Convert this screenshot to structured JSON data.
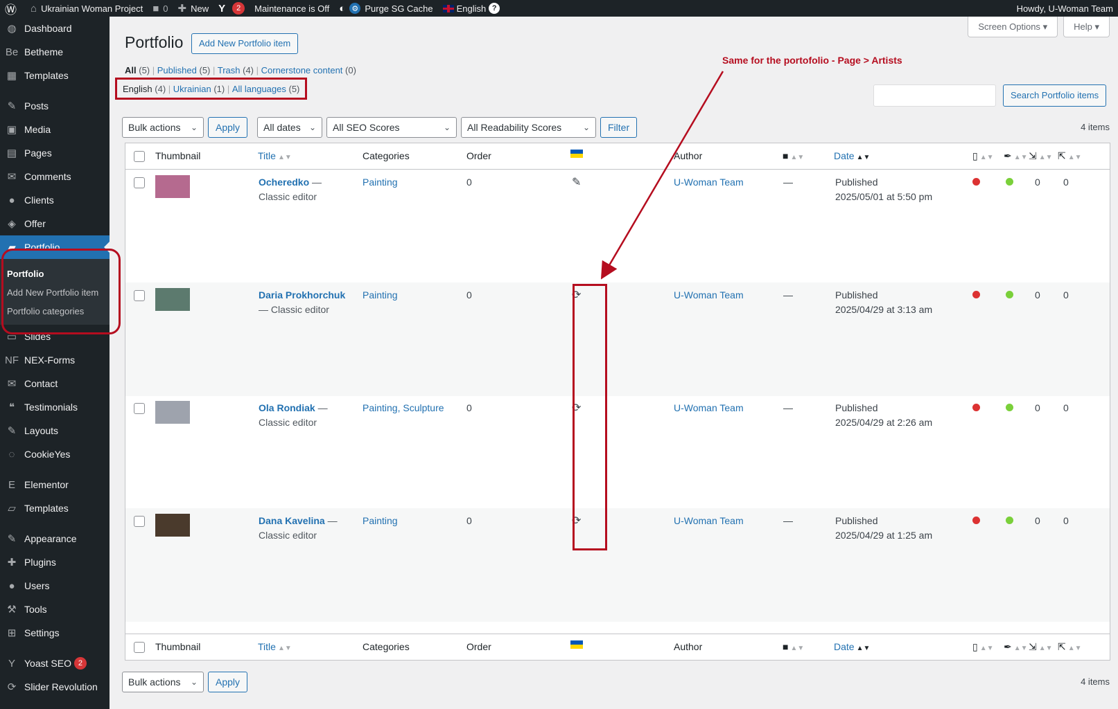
{
  "adminbar": {
    "site": "Ukrainian Woman Project",
    "comments": "0",
    "new_label": "New",
    "yoast_count": "2",
    "maintenance": "Maintenance is Off",
    "purge": "Purge SG Cache",
    "language": "English",
    "howdy": "Howdy, U-Woman Team"
  },
  "sidebar": {
    "items": [
      {
        "label": "Dashboard",
        "icon": "dashboard-icon",
        "glyph": "◍"
      },
      {
        "label": "Betheme",
        "icon": "betheme-icon",
        "glyph": "Be"
      },
      {
        "label": "Templates",
        "icon": "templates-icon",
        "glyph": "▦"
      },
      {
        "label": "Posts",
        "icon": "pin-icon",
        "glyph": "✎"
      },
      {
        "label": "Media",
        "icon": "media-icon",
        "glyph": "▣"
      },
      {
        "label": "Pages",
        "icon": "pages-icon",
        "glyph": "▤"
      },
      {
        "label": "Comments",
        "icon": "comments-icon",
        "glyph": "✉"
      },
      {
        "label": "Clients",
        "icon": "clients-icon",
        "glyph": "●"
      },
      {
        "label": "Offer",
        "icon": "offer-icon",
        "glyph": "◈"
      },
      {
        "label": "Portfolio",
        "icon": "portfolio-icon",
        "glyph": "▰"
      },
      {
        "label": "Slides",
        "icon": "slides-icon",
        "glyph": "▭"
      },
      {
        "label": "NEX-Forms",
        "icon": "nex-forms-icon",
        "glyph": "NF"
      },
      {
        "label": "Contact",
        "icon": "contact-icon",
        "glyph": "✉"
      },
      {
        "label": "Testimonials",
        "icon": "quote-icon",
        "glyph": "❝"
      },
      {
        "label": "Layouts",
        "icon": "layouts-icon",
        "glyph": "✎"
      },
      {
        "label": "CookieYes",
        "icon": "cookieyes-icon",
        "glyph": "◌"
      },
      {
        "label": "Elementor",
        "icon": "elementor-icon",
        "glyph": "E"
      },
      {
        "label": "Templates",
        "icon": "folder-icon",
        "glyph": "▱"
      },
      {
        "label": "Appearance",
        "icon": "appearance-icon",
        "glyph": "✎"
      },
      {
        "label": "Plugins",
        "icon": "plugins-icon",
        "glyph": "✚"
      },
      {
        "label": "Users",
        "icon": "users-icon",
        "glyph": "●"
      },
      {
        "label": "Tools",
        "icon": "tools-icon",
        "glyph": "⚒"
      },
      {
        "label": "Settings",
        "icon": "settings-icon",
        "glyph": "⊞"
      },
      {
        "label": "Yoast SEO",
        "icon": "yoast-icon",
        "glyph": "Y",
        "badge": "2"
      },
      {
        "label": "Slider Revolution",
        "icon": "slider-revolution-icon",
        "glyph": "⟳"
      }
    ],
    "submenu": [
      "Portfolio",
      "Add New Portfolio item",
      "Portfolio categories"
    ]
  },
  "page": {
    "title": "Portfolio",
    "add_new": "Add New Portfolio item",
    "screen_options": "Screen Options",
    "help": "Help",
    "subsubsub": [
      {
        "label": "All",
        "count": "(5)"
      },
      {
        "label": "Published",
        "count": "(5)"
      },
      {
        "label": "Trash",
        "count": "(4)"
      },
      {
        "label": "Cornerstone content",
        "count": "(0)"
      }
    ],
    "languages": [
      {
        "label": "English",
        "count": "(4)"
      },
      {
        "label": "Ukrainian",
        "count": "(1)"
      },
      {
        "label": "All languages",
        "count": "(5)"
      }
    ],
    "annotation": "Same for the portofolio - Page > Artists",
    "search_button": "Search Portfolio items",
    "bulk_actions": "Bulk actions",
    "apply": "Apply",
    "all_dates": "All dates",
    "all_seo": "All SEO Scores",
    "all_readability": "All Readability Scores",
    "filter": "Filter",
    "items_count": "4 items"
  },
  "table": {
    "columns": {
      "thumbnail": "Thumbnail",
      "title": "Title",
      "categories": "Categories",
      "order": "Order",
      "author": "Author",
      "date": "Date"
    },
    "rows": [
      {
        "name": "Ocheredko",
        "suffix": " — Classic editor",
        "categories": "Painting",
        "order": "0",
        "lang_icon": "pencil-icon",
        "lang_glyph": "✎",
        "author": "U-Woman Team",
        "comments": "—",
        "status": "Published",
        "date": "2025/05/01 at 5:50 pm",
        "links_out": "0",
        "links_in": "0",
        "thumb_color": "#b56a8f"
      },
      {
        "name": "Daria Prokhorchuk",
        "suffix": " — Classic editor",
        "categories": "Painting",
        "order": "0",
        "lang_icon": "sync-icon",
        "lang_glyph": "⟳",
        "author": "U-Woman Team",
        "comments": "—",
        "status": "Published",
        "date": "2025/04/29 at 3:13 am",
        "links_out": "0",
        "links_in": "0",
        "thumb_color": "#5c7a6e"
      },
      {
        "name": "Ola Rondiak",
        "suffix": " — Classic editor",
        "categories": "Painting, Sculpture",
        "order": "0",
        "lang_icon": "sync-icon",
        "lang_glyph": "⟳",
        "author": "U-Woman Team",
        "comments": "—",
        "status": "Published",
        "date": "2025/04/29 at 2:26 am",
        "links_out": "0",
        "links_in": "0",
        "thumb_color": "#9ea3ad"
      },
      {
        "name": "Dana Kavelina",
        "suffix": " — Classic editor",
        "categories": "Painting",
        "order": "0",
        "lang_icon": "sync-icon",
        "lang_glyph": "⟳",
        "author": "U-Woman Team",
        "comments": "—",
        "status": "Published",
        "date": "2025/04/29 at 1:25 am",
        "links_out": "0",
        "links_in": "0",
        "thumb_color": "#4a3a2c"
      }
    ]
  },
  "colors": {
    "accent": "#2271b1",
    "annotation": "#b50d1f",
    "seo_bad": "#dc3232",
    "readability_good": "#7ad03a"
  }
}
